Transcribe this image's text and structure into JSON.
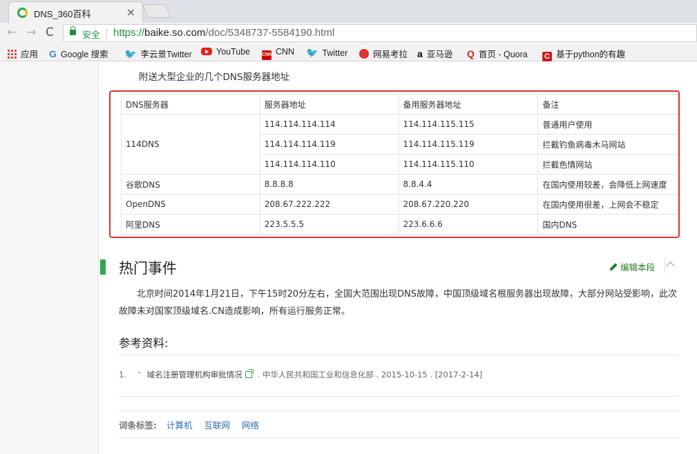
{
  "browser": {
    "tab_title": "DNS_360百科",
    "tab_close": "×",
    "secure_label": "安全",
    "url_scheme": "https://",
    "url_host": "baike.so.com",
    "url_path": "/doc/5348737-5584190.html",
    "nav_back": "←",
    "nav_forward": "→",
    "nav_reload": "C",
    "accent_color": "#1e8e3e"
  },
  "bookmarks": [
    {
      "label": "应用",
      "icon": "apps-icon"
    },
    {
      "label": "Google 搜索",
      "icon": "google-icon"
    },
    {
      "label": "李云景Twitter",
      "icon": "twitter-icon"
    },
    {
      "label": "YouTube",
      "icon": "youtube-icon"
    },
    {
      "label": "CNN",
      "icon": "cnn-icon"
    },
    {
      "label": "Twitter",
      "icon": "twitter-icon"
    },
    {
      "label": "网易考拉",
      "icon": "netease-kaola-icon"
    },
    {
      "label": "亚马逊",
      "icon": "amazon-icon"
    },
    {
      "label": "首页 - Quora",
      "icon": "quora-icon"
    },
    {
      "label": "基于python的有趣",
      "icon": "csdn-icon"
    }
  ],
  "article": {
    "intro": "附送大型企业的几个DNS服务器地址",
    "table": {
      "headers": [
        "DNS服务器",
        "服务器地址",
        "备用服务器地址",
        "备注"
      ],
      "rows": [
        {
          "provider": "114DNS",
          "primary": "114.114.114.114",
          "secondary": "114.114.115.115",
          "note": "普通用户使用"
        },
        {
          "provider": "",
          "primary": "114.114.114.119",
          "secondary": "114.114.115.119",
          "note": "拦截钓鱼病毒木马网站"
        },
        {
          "provider": "",
          "primary": "114.114.114.110",
          "secondary": "114.114.115.110",
          "note": "拦截色情网站"
        },
        {
          "provider": "谷歌DNS",
          "primary": "8.8.8.8",
          "secondary": "8.8.4.4",
          "note": "在国内使用较差，会降低上网速度"
        },
        {
          "provider": "OpenDNS",
          "primary": "208.67.222.222",
          "secondary": "208.67.220.220",
          "note": "在国内使用很差，上网会不稳定"
        },
        {
          "provider": "阿里DNS",
          "primary": "223.5.5.5",
          "secondary": "223.6.6.6",
          "note": "国内DNS"
        }
      ]
    },
    "section_title": "热门事件",
    "edit_label": "编辑本段",
    "section_text": "北京时间2014年1月21日，下午15时20分左右，全国大范围出现DNS故障，中国顶级域名根服务器出现故障，大部分网站受影响，此次故障未对国家顶级域名.CN造成影响，所有运行服务正常。",
    "references_title": "参考资料:",
    "reference": {
      "number": "1.",
      "up": "⌃",
      "title": "域名注册管理机构审批情况",
      "source": ". 中华人民共和国工业和信息化部 . 2015-10-15 . [2017-2-14]"
    },
    "tags_label": "词条标签:",
    "tags": [
      "计算机",
      "互联网",
      "网络"
    ]
  }
}
